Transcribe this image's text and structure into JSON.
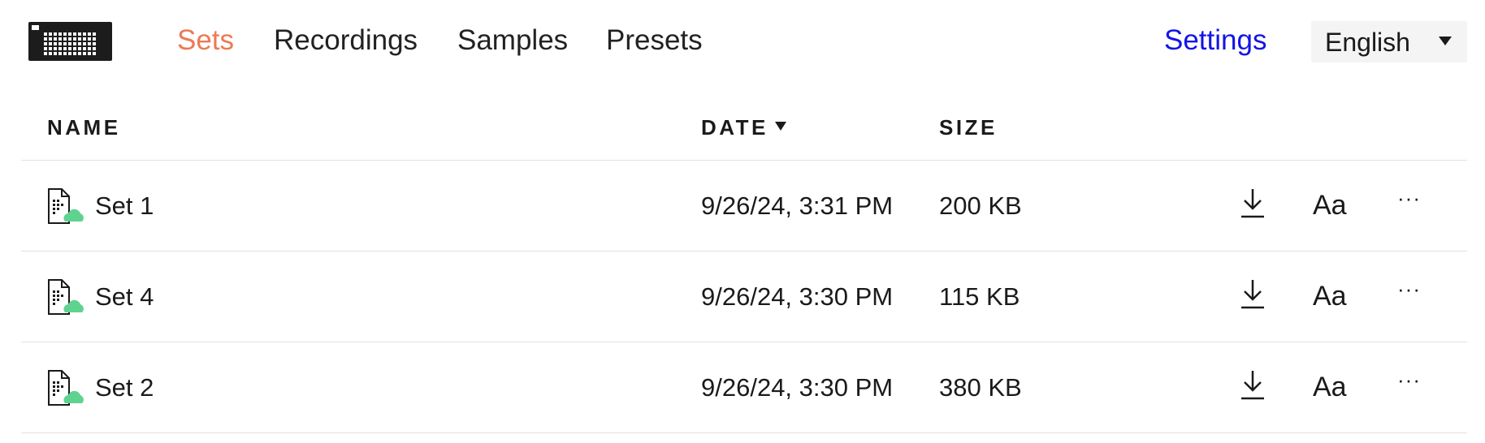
{
  "header": {
    "logo_icon": "pad-grid-logo-icon",
    "nav": [
      {
        "label": "Sets",
        "active": true
      },
      {
        "label": "Recordings",
        "active": false
      },
      {
        "label": "Samples",
        "active": false
      },
      {
        "label": "Presets",
        "active": false
      }
    ],
    "settings_label": "Settings",
    "language": {
      "selected": "English",
      "icon": "caret-down-icon"
    }
  },
  "table": {
    "columns": {
      "name": "NAME",
      "date": "DATE",
      "size": "SIZE"
    },
    "sort": {
      "column": "date",
      "direction": "descending",
      "icon": "sort-caret-down-icon"
    },
    "rows": [
      {
        "name": "Set 1",
        "date": "9/26/24, 3:31 PM",
        "size": "200 KB",
        "font_label": "Aa",
        "more_label": "···",
        "icon": "set-file-cloud-icon"
      },
      {
        "name": "Set 4",
        "date": "9/26/24, 3:30 PM",
        "size": "115 KB",
        "font_label": "Aa",
        "more_label": "···",
        "icon": "set-file-cloud-icon"
      },
      {
        "name": "Set 2",
        "date": "9/26/24, 3:30 PM",
        "size": "380 KB",
        "font_label": "Aa",
        "more_label": "···",
        "icon": "set-file-cloud-icon"
      }
    ]
  },
  "colors": {
    "active_nav": "#ec7a55",
    "settings_link": "#1414e6",
    "cloud_badge": "#5ed38f",
    "divider": "#e2e2e2"
  }
}
